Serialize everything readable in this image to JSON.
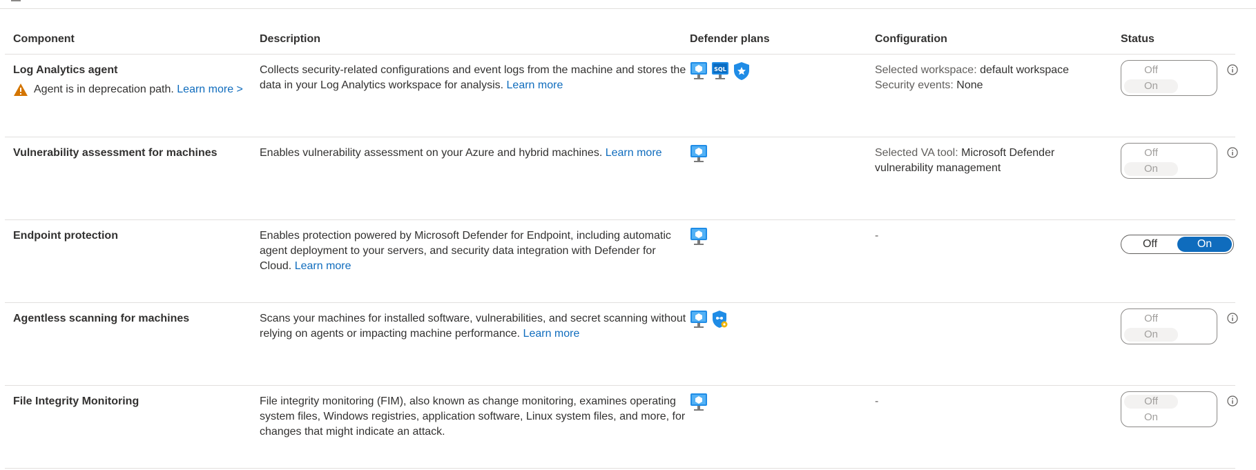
{
  "columns": {
    "component": "Component",
    "description": "Description",
    "plans": "Defender plans",
    "configuration": "Configuration",
    "status": "Status"
  },
  "colors": {
    "accent": "#0f6cbd",
    "warning": "#d47500",
    "border": "#e1dfdd"
  },
  "rows": [
    {
      "name": "Log Analytics agent",
      "warning": "Agent is in deprecation path.",
      "warning_link": "Learn more >",
      "description": "Collects security-related configurations and event logs from the machine and stores the data in your Log Analytics workspace for analysis.",
      "link": "Learn more",
      "plans": [
        "servers-icon",
        "sql-server-icon",
        "shield-star-icon"
      ],
      "config": [
        {
          "label": "Selected workspace:",
          "value": "default workspace"
        },
        {
          "label": "Security events:",
          "value": "None"
        }
      ],
      "status": {
        "off": "Off",
        "on": "On",
        "selected": "On",
        "enabled": false
      }
    },
    {
      "name": "Vulnerability assessment for machines",
      "description": "Enables vulnerability assessment on your Azure and hybrid machines.",
      "link": "Learn more",
      "plans": [
        "servers-icon"
      ],
      "config": [
        {
          "label": "Selected VA tool:",
          "value": "Microsoft Defender vulnerability management"
        }
      ],
      "status": {
        "off": "Off",
        "on": "On",
        "selected": "On",
        "enabled": false
      }
    },
    {
      "name": "Endpoint protection",
      "description": "Enables protection powered by Microsoft Defender for Endpoint, including automatic agent deployment to your servers, and security data integration with Defender for Cloud.",
      "link": "Learn more",
      "plans": [
        "servers-icon"
      ],
      "config_text": "-",
      "status": {
        "off": "Off",
        "on": "On",
        "selected": "On",
        "enabled": true
      }
    },
    {
      "name": "Agentless scanning for machines",
      "description": "Scans your machines for installed software, vulnerabilities, and secret scanning without relying on agents or impacting machine performance.",
      "link": "Learn more",
      "plans": [
        "servers-icon",
        "cspm-shield-icon"
      ],
      "status": {
        "off": "Off",
        "on": "On",
        "selected": "On",
        "enabled": false
      }
    },
    {
      "name": "File Integrity Monitoring",
      "description": "File integrity monitoring (FIM), also known as change monitoring, examines operating system files, Windows registries, application software, Linux system files, and more, for changes that might indicate an attack.",
      "plans": [
        "servers-icon"
      ],
      "config_text": "-",
      "status": {
        "off": "Off",
        "on": "On",
        "selected": "Off",
        "enabled": false
      }
    }
  ]
}
